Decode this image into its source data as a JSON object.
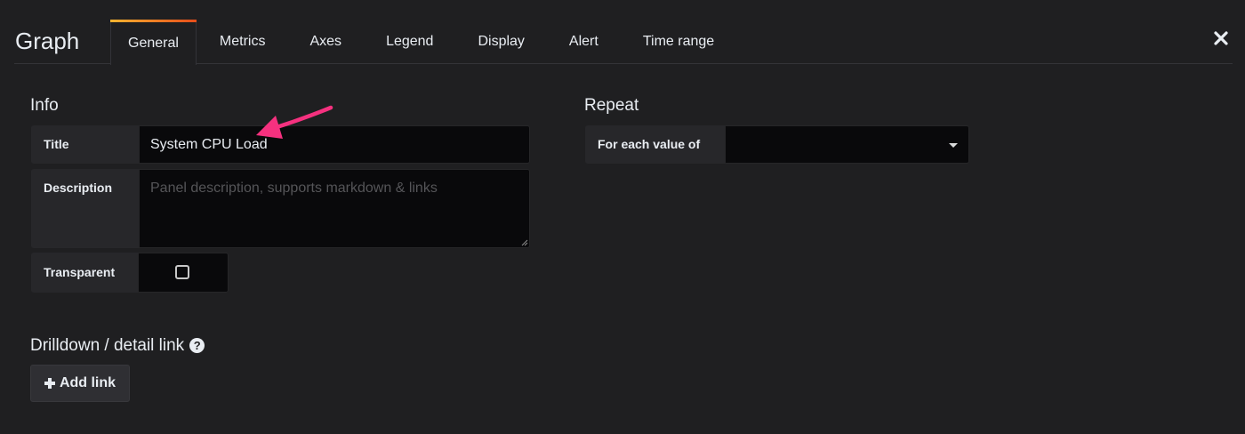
{
  "header": {
    "panel_title": "Graph",
    "tabs": [
      {
        "label": "General",
        "active": true
      },
      {
        "label": "Metrics",
        "active": false
      },
      {
        "label": "Axes",
        "active": false
      },
      {
        "label": "Legend",
        "active": false
      },
      {
        "label": "Display",
        "active": false
      },
      {
        "label": "Alert",
        "active": false
      },
      {
        "label": "Time range",
        "active": false
      }
    ],
    "close_icon": "close-icon"
  },
  "info": {
    "section_title": "Info",
    "title_label": "Title",
    "title_value": "System CPU Load",
    "description_label": "Description",
    "description_value": "",
    "description_placeholder": "Panel description, supports markdown & links",
    "transparent_label": "Transparent",
    "transparent_checked": false
  },
  "repeat": {
    "section_title": "Repeat",
    "for_each_label": "For each value of",
    "for_each_value": ""
  },
  "drilldown": {
    "section_title": "Drilldown / detail link",
    "help_icon": "question-circle-icon",
    "add_link_label": "Add link"
  },
  "annotation": {
    "arrow_color": "#f5317f"
  },
  "colors": {
    "background": "#1f1f21",
    "tab_accent_start": "#f7b430",
    "tab_accent_end": "#e64d1a",
    "input_background": "#09090b",
    "label_background": "#27272a"
  }
}
